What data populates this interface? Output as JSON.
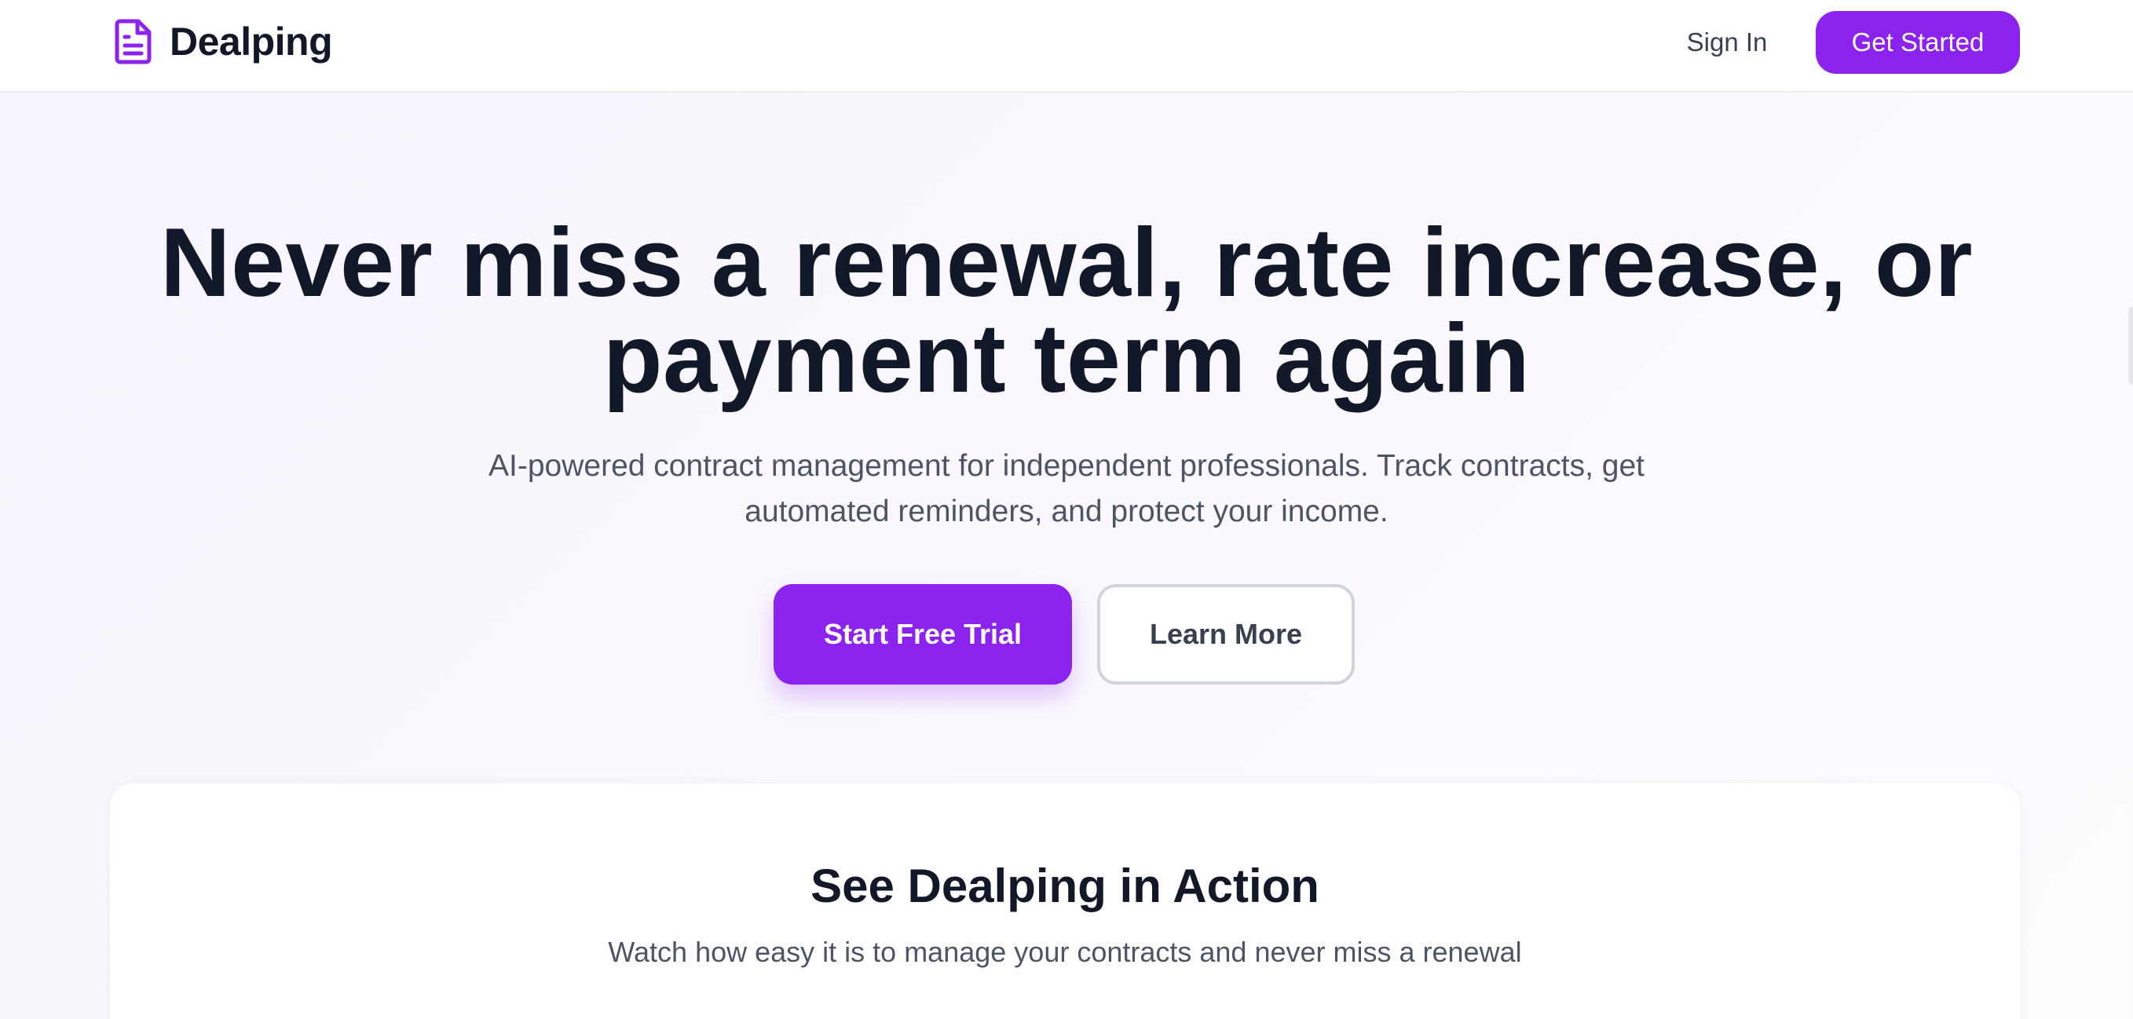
{
  "header": {
    "brand_name": "Dealping",
    "brand_icon": "document-icon",
    "sign_in_label": "Sign In",
    "get_started_label": "Get Started"
  },
  "hero": {
    "title": "Never miss a renewal, rate increase, or payment term again",
    "subtitle": "AI-powered contract management for independent professionals. Track contracts, get automated reminders, and protect your income.",
    "primary_cta": "Start Free Trial",
    "secondary_cta": "Learn More"
  },
  "demo": {
    "title": "See Dealping in Action",
    "subtitle": "Watch how easy it is to manage your contracts and never miss a renewal"
  },
  "colors": {
    "accent": "#8b22ee",
    "text_dark": "#111827",
    "text_muted": "#4b5563"
  }
}
